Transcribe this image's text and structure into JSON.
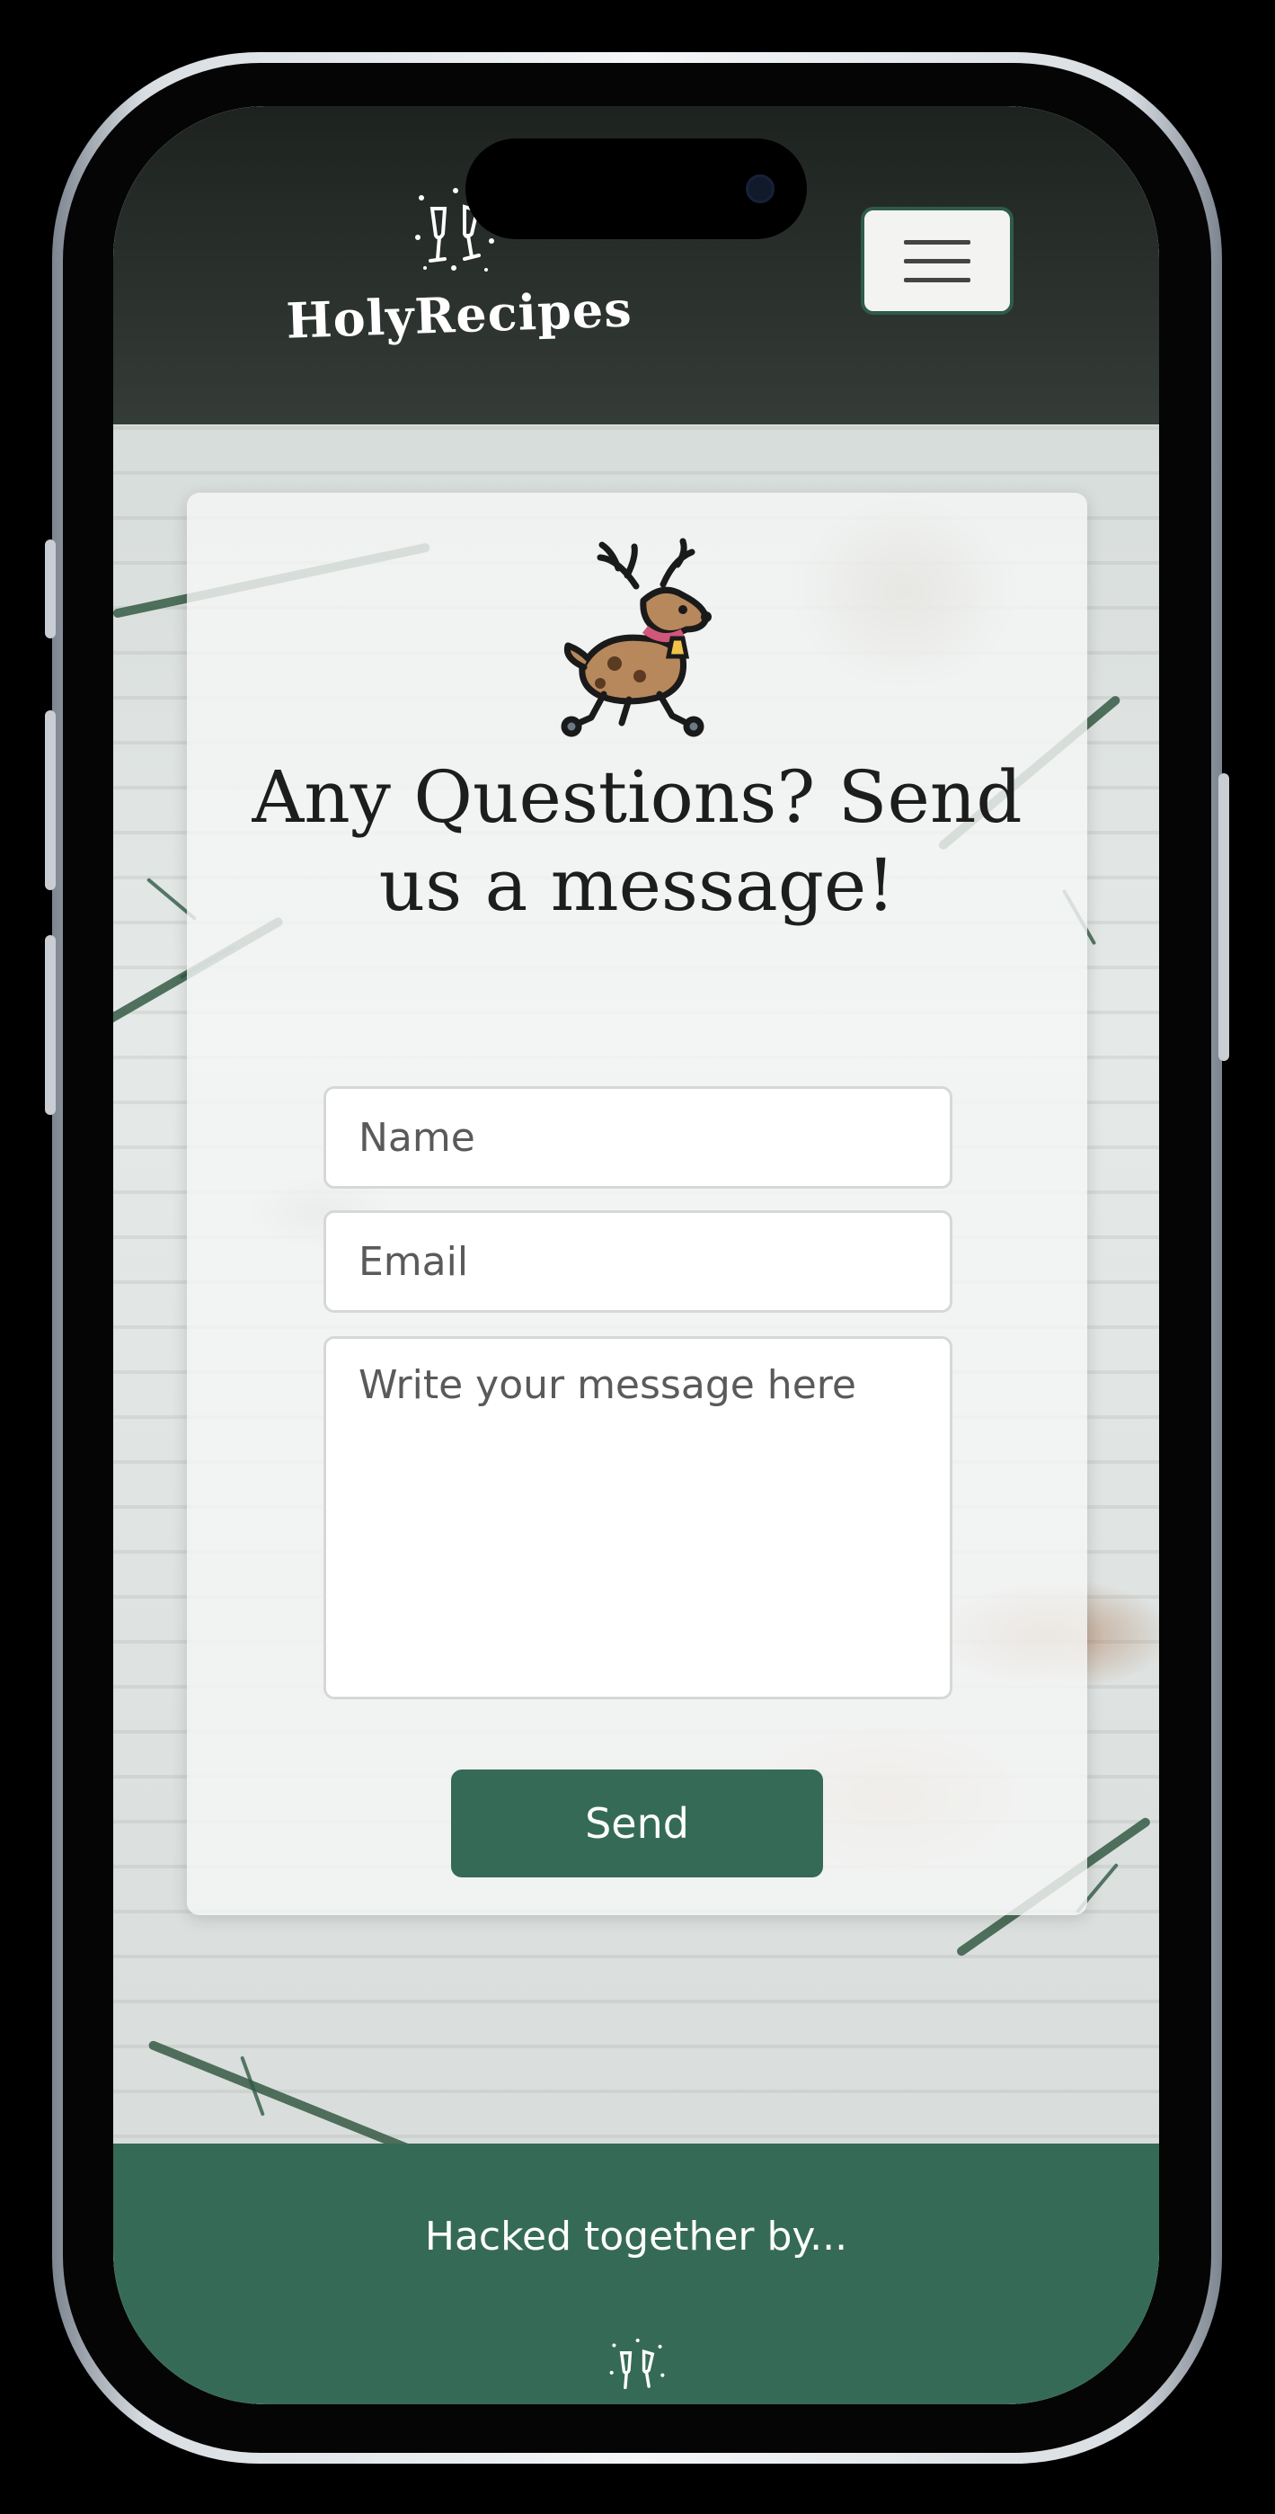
{
  "header": {
    "logo_text": "HolyRecipes",
    "logo_icon": "champagne-glasses-icon",
    "menu_icon": "hamburger-menu-icon"
  },
  "contact": {
    "illustration": "reindeer-icon",
    "heading": "Any Questions? Send us a message!",
    "name_placeholder": "Name",
    "email_placeholder": "Email",
    "message_placeholder": "Write your message here",
    "send_label": "Send"
  },
  "footer": {
    "text": "Hacked together by...",
    "icon": "champagne-glasses-icon"
  },
  "colors": {
    "brand_green": "#356b56",
    "header_dark": "#1e2621",
    "menu_border": "#2f5b49"
  }
}
